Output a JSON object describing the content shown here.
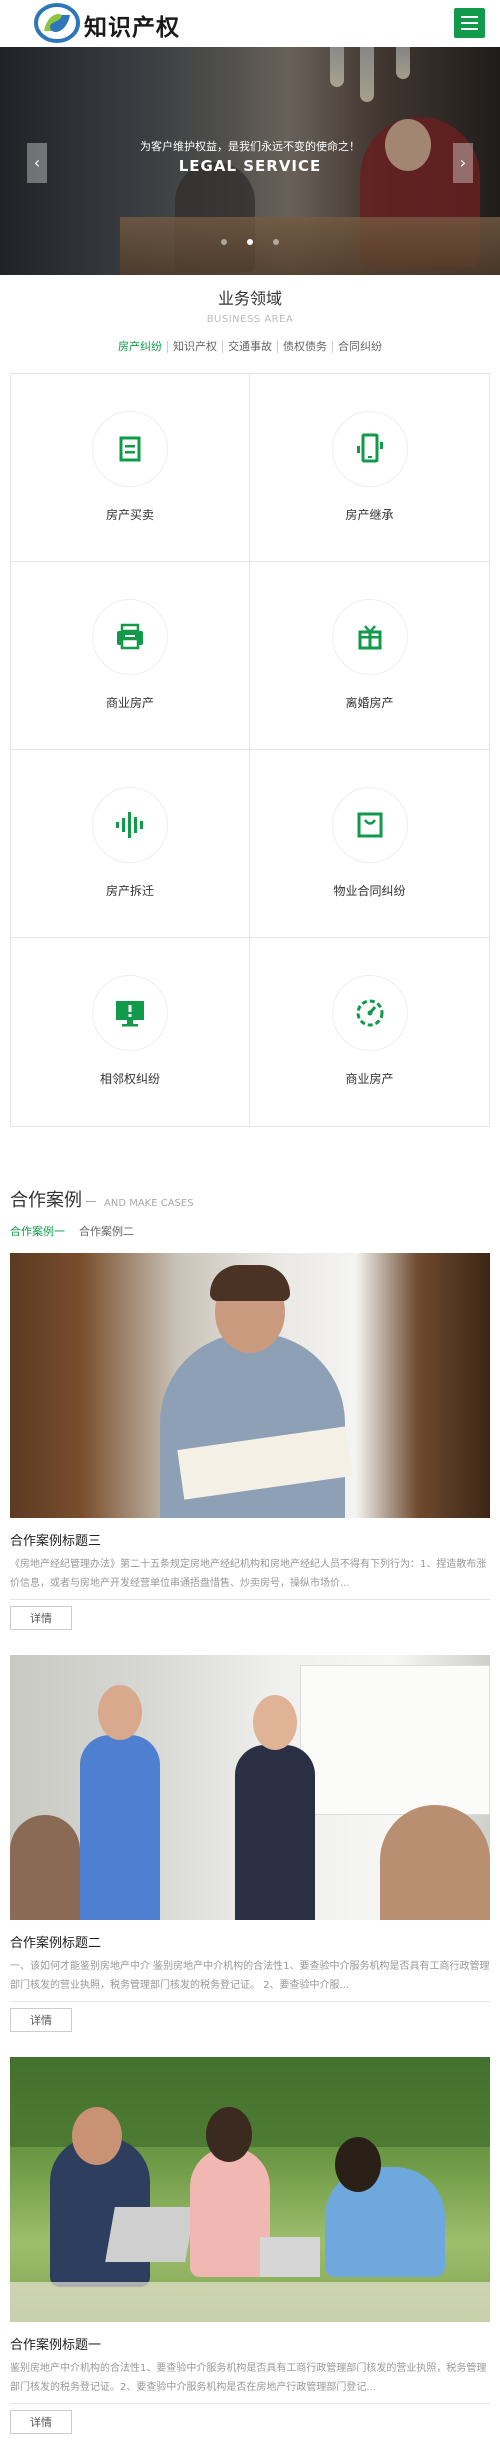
{
  "header": {
    "logo_text": "知识产权",
    "colors": {
      "brand": "#109a49"
    }
  },
  "banner": {
    "subtitle": "为客户维护权益，是我们永远不变的使命之！",
    "title": "LEGAL SERVICE",
    "prev": "‹",
    "next": "›"
  },
  "business": {
    "title": "业务领域",
    "subtitle": "BUSINESS AREA",
    "tabs": [
      "房产纠纷",
      "知识产权",
      "交通事故",
      "债权债务",
      "合同纠纷"
    ],
    "items": [
      {
        "label": "房产买卖",
        "icon": "document-icon"
      },
      {
        "label": "房产继承",
        "icon": "phone-icon"
      },
      {
        "label": "商业房产",
        "icon": "printer-icon"
      },
      {
        "label": "离婚房产",
        "icon": "gift-icon"
      },
      {
        "label": "房产拆迁",
        "icon": "sound-wave-icon"
      },
      {
        "label": "物业合同纠纷",
        "icon": "bag-icon"
      },
      {
        "label": "相邻权纠纷",
        "icon": "monitor-icon"
      },
      {
        "label": "商业房产",
        "icon": "dashboard-icon"
      }
    ]
  },
  "cases": {
    "title": "合作案例",
    "subtitle": "AND MAKE CASES",
    "tabs": [
      "合作案例一",
      "合作案例二"
    ],
    "button_label": "详情",
    "items": [
      {
        "title": "合作案例标题三",
        "desc": "《房地产经纪管理办法》第二十五条规定房地产经纪机构和房地产经纪人员不得有下列行为：1、捏造散布涨价信息，或者与房地产开发经营单位串通捂盘惜售、炒卖房号，操纵市场价..."
      },
      {
        "title": "合作案例标题二",
        "desc": "一、该如何才能鉴别房地产中介 鉴别房地产中介机构的合法性1、要查验中介服务机构是否具有工商行政管理部门核发的营业执照，税务管理部门核发的税务登记证。 2、要查验中介服..."
      },
      {
        "title": "合作案例标题一",
        "desc": "鉴别房地产中介机构的合法性1、要查验中介服务机构是否具有工商行政管理部门核发的营业执照，税务管理部门核发的税务登记证。2、要查验中介服务机构是否在房地产行政管理部门登记..."
      }
    ]
  }
}
